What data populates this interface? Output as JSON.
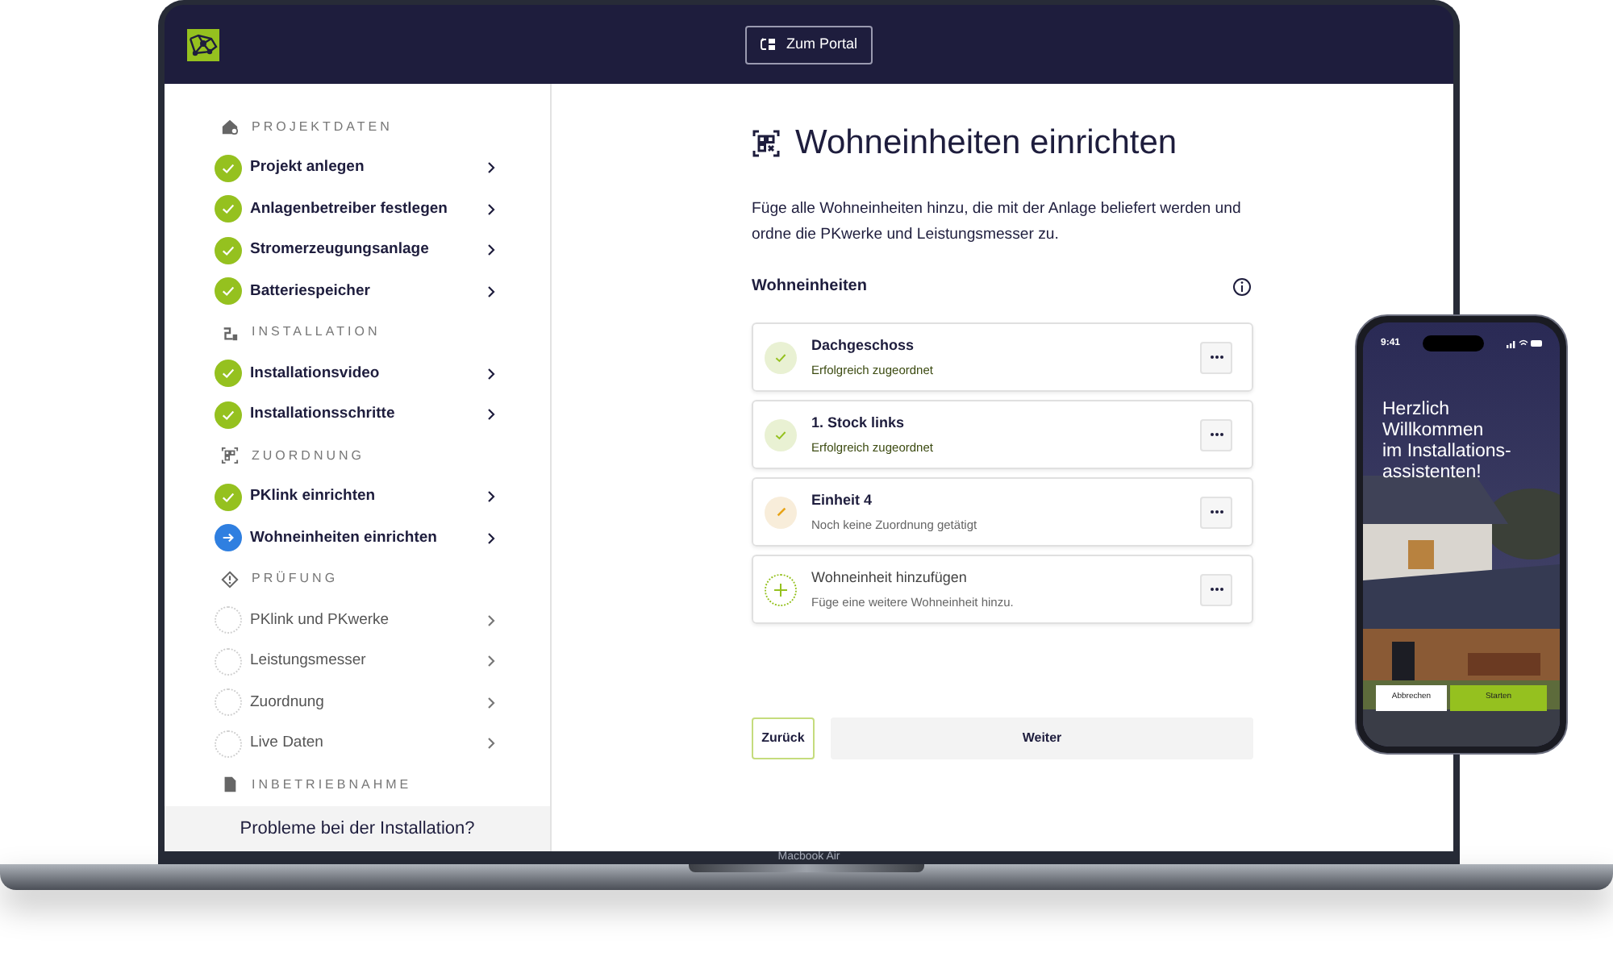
{
  "header": {
    "portal_button": "Zum Portal"
  },
  "sidebar": {
    "sections": [
      {
        "title": "PROJEKTDATEN",
        "items": [
          {
            "label": "Projekt anlegen",
            "completed": true,
            "selected": false
          },
          {
            "label": "Anlagenbetreiber festlegen",
            "completed": true,
            "selected": false
          },
          {
            "label": "Stromerzeugungsanlage",
            "completed": true,
            "selected": false
          },
          {
            "label": "Batteriespeicher",
            "completed": true,
            "selected": false
          }
        ]
      },
      {
        "title": "INSTALLATION",
        "items": [
          {
            "label": "Installationsvideo",
            "completed": true,
            "selected": false
          },
          {
            "label": "Installationsschritte",
            "completed": true,
            "selected": false
          }
        ]
      },
      {
        "title": "ZUORDNUNG",
        "items": [
          {
            "label": "PKlink einrichten",
            "completed": true,
            "selected": false
          },
          {
            "label": "Wohneinheiten einrichten",
            "completed": false,
            "selected": true
          }
        ]
      },
      {
        "title": "PRÜFUNG",
        "items": [
          {
            "label": "PKlink und PKwerke",
            "completed": false,
            "selected": false
          },
          {
            "label": "Leistungsmesser",
            "completed": false,
            "selected": false
          },
          {
            "label": "Zuordnung",
            "completed": false,
            "selected": false
          },
          {
            "label": "Live Daten",
            "completed": false,
            "selected": false
          }
        ]
      },
      {
        "title": "INBETRIEBNAHME"
      }
    ],
    "help_link": "Probleme bei der Installation?"
  },
  "main": {
    "title": "Wohneinheiten einrichten",
    "intro": "Füge alle Wohneinheiten hinzu, die mit der Anlage beliefert werden und ordne die PKwerke und Leistungsmesser zu.",
    "list_heading": "Wohneinheiten",
    "units": [
      {
        "name": "Dachgeschoss",
        "status_text": "Erfolgreich zugeordnet",
        "kind": "assigned"
      },
      {
        "name": "1. Stock links",
        "status_text": "Erfolgreich zugeordnet",
        "kind": "assigned"
      },
      {
        "name": "Einheit 4",
        "status_text": "Noch keine Zuordnung getätigt",
        "kind": "pending"
      },
      {
        "name": "Wohneinheit hinzufügen",
        "status_text": "Füge eine weitere Wohneinheit hinzu.",
        "kind": "add"
      }
    ],
    "back_button": "Zurück",
    "next_button": "Weiter"
  },
  "device_label": "Macbook Air",
  "phone": {
    "time": "9:41",
    "greeting": "Herzlich\nWillkommen\nim Installations-\nassistenten!",
    "cancel_button": "Abbrechen",
    "start_button": "Starten"
  }
}
